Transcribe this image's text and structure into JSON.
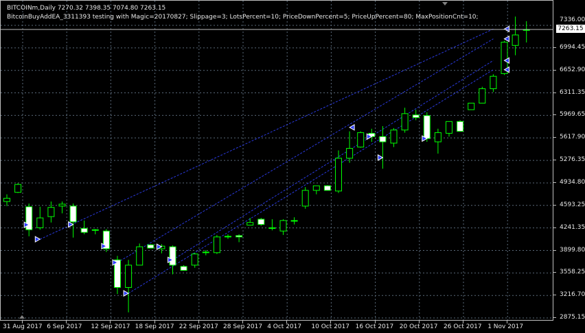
{
  "header": {
    "symbol_line": "BITCOINm,Daily  7270.32 7398.35 7074.80 7263.15",
    "ea_line": "BitcoinBuyAddEA_3311393 testing with Magic=20170827; Slippage=3; LotsPercent=10; PriceDownPercent=5; PriceUpPercent=80; MaxPositionCnt=10;"
  },
  "price_axis": {
    "labels": [
      "7336.00",
      "6994.45",
      "6652.90",
      "6311.35",
      "5969.65",
      "5617.90",
      "5276.35",
      "4934.80",
      "4593.25",
      "4241.35",
      "3899.80",
      "3558.25",
      "3216.70",
      "2875.15"
    ],
    "current_price": "7263.15"
  },
  "time_axis": {
    "labels": [
      "31 Aug 2017",
      "6 Sep 2017",
      "12 Sep 2017",
      "18 Sep 2017",
      "22 Sep 2017",
      "28 Sep 2017",
      "4 Oct 2017",
      "10 Oct 2017",
      "16 Oct 2017",
      "20 Oct 2017",
      "26 Oct 2017",
      "1 Nov 2017"
    ]
  },
  "colors": {
    "background": "#000000",
    "grid": "#5a6a7a",
    "bull_candle": "#000000",
    "bear_candle": "#ffffff",
    "candle_outline": "#00ff00",
    "trend_lines": "#2a3ae0",
    "arrow_marker": "#3040ff"
  },
  "chart_data": {
    "type": "candlestick",
    "series": [
      {
        "o": 4650,
        "h": 4760,
        "l": 4580,
        "c": 4700
      },
      {
        "o": 4790,
        "h": 4930,
        "l": 4780,
        "c": 4910
      },
      {
        "o": 4570,
        "h": 4620,
        "l": 4120,
        "c": 4220
      },
      {
        "o": 4250,
        "h": 4570,
        "l": 4220,
        "c": 4400
      },
      {
        "o": 4420,
        "h": 4650,
        "l": 4330,
        "c": 4560
      },
      {
        "o": 4580,
        "h": 4650,
        "l": 4470,
        "c": 4610
      },
      {
        "o": 4580,
        "h": 4620,
        "l": 4100,
        "c": 4340
      },
      {
        "o": 4240,
        "h": 4360,
        "l": 4150,
        "c": 4180
      },
      {
        "o": 4220,
        "h": 4230,
        "l": 4150,
        "c": 4210
      },
      {
        "o": 4200,
        "h": 4230,
        "l": 3880,
        "c": 3930
      },
      {
        "o": 3760,
        "h": 3820,
        "l": 3240,
        "c": 3340
      },
      {
        "o": 3340,
        "h": 3760,
        "l": 2960,
        "c": 3680
      },
      {
        "o": 3680,
        "h": 4010,
        "l": 3690,
        "c": 3960
      },
      {
        "o": 3990,
        "h": 4000,
        "l": 3960,
        "c": 3940
      },
      {
        "o": 3930,
        "h": 4000,
        "l": 3860,
        "c": 3970
      },
      {
        "o": 3960,
        "h": 3980,
        "l": 3540,
        "c": 3680
      },
      {
        "o": 3660,
        "h": 3680,
        "l": 3620,
        "c": 3600
      },
      {
        "o": 3680,
        "h": 3870,
        "l": 3640,
        "c": 3850
      },
      {
        "o": 3870,
        "h": 3910,
        "l": 3830,
        "c": 3880
      },
      {
        "o": 3870,
        "h": 4140,
        "l": 3850,
        "c": 4110
      },
      {
        "o": 4110,
        "h": 4150,
        "l": 4080,
        "c": 4120
      },
      {
        "o": 4130,
        "h": 4150,
        "l": 4030,
        "c": 4110
      },
      {
        "o": 4290,
        "h": 4400,
        "l": 4290,
        "c": 4330
      },
      {
        "o": 4380,
        "h": 4400,
        "l": 4280,
        "c": 4300
      },
      {
        "o": 4250,
        "h": 4380,
        "l": 4210,
        "c": 4250
      },
      {
        "o": 4200,
        "h": 4380,
        "l": 4140,
        "c": 4360
      },
      {
        "o": 4350,
        "h": 4410,
        "l": 4300,
        "c": 4360
      },
      {
        "o": 4580,
        "h": 4870,
        "l": 4540,
        "c": 4820
      },
      {
        "o": 4820,
        "h": 4880,
        "l": 4760,
        "c": 4890
      },
      {
        "o": 4890,
        "h": 4900,
        "l": 4840,
        "c": 4820
      },
      {
        "o": 4810,
        "h": 5430,
        "l": 4780,
        "c": 5310
      },
      {
        "o": 5310,
        "h": 5720,
        "l": 5240,
        "c": 5460
      },
      {
        "o": 5480,
        "h": 5720,
        "l": 5470,
        "c": 5700
      },
      {
        "o": 5690,
        "h": 5760,
        "l": 5560,
        "c": 5640
      },
      {
        "o": 5640,
        "h": 5800,
        "l": 5150,
        "c": 5560
      },
      {
        "o": 5540,
        "h": 5770,
        "l": 5480,
        "c": 5740
      },
      {
        "o": 5740,
        "h": 6080,
        "l": 5700,
        "c": 5990
      },
      {
        "o": 5970,
        "h": 6050,
        "l": 5890,
        "c": 5930
      },
      {
        "o": 5960,
        "h": 6010,
        "l": 5560,
        "c": 5610
      },
      {
        "o": 5560,
        "h": 5760,
        "l": 5380,
        "c": 5700
      },
      {
        "o": 5690,
        "h": 5870,
        "l": 5640,
        "c": 5870
      },
      {
        "o": 5870,
        "h": 5890,
        "l": 5740,
        "c": 5720
      },
      {
        "o": 6050,
        "h": 6100,
        "l": 6050,
        "c": 6150
      },
      {
        "o": 6150,
        "h": 6400,
        "l": 6150,
        "c": 6370
      },
      {
        "o": 6370,
        "h": 6590,
        "l": 6320,
        "c": 6560
      },
      {
        "o": 6600,
        "h": 7100,
        "l": 6580,
        "c": 7080
      },
      {
        "o": 7030,
        "h": 7470,
        "l": 6880,
        "c": 7190
      },
      {
        "o": 7270,
        "h": 7400,
        "l": 7075,
        "c": 7263
      }
    ],
    "buy_arrows": [
      {
        "i": 2,
        "p": 4295
      },
      {
        "i": 3,
        "p": 4075
      },
      {
        "i": 6,
        "p": 4300
      },
      {
        "i": 9,
        "p": 3970
      },
      {
        "i": 10,
        "p": 3720
      },
      {
        "i": 11,
        "p": 3250
      },
      {
        "i": 14,
        "p": 3960
      },
      {
        "i": 15,
        "p": 3760
      },
      {
        "i": 33,
        "p": 5640
      },
      {
        "i": 34,
        "p": 5320
      },
      {
        "i": 38,
        "p": 5610
      }
    ],
    "close_arrows": [
      {
        "i": 31,
        "p": 5780
      },
      {
        "i": 45,
        "p": 7280
      },
      {
        "i": 45,
        "p": 7130
      },
      {
        "i": 45,
        "p": 6800
      },
      {
        "i": 45,
        "p": 6660
      }
    ],
    "trend_lines": [
      {
        "from": {
          "i": 3,
          "p": 4075
        },
        "to": {
          "i": 44,
          "p": 7280
        }
      },
      {
        "from": {
          "i": 10,
          "p": 3720
        },
        "to": {
          "i": 44,
          "p": 7130
        }
      },
      {
        "from": {
          "i": 11,
          "p": 3250
        },
        "to": {
          "i": 44,
          "p": 6660
        }
      },
      {
        "from": {
          "i": 15,
          "p": 3760
        },
        "to": {
          "i": 44,
          "p": 6800
        }
      }
    ],
    "ylim": [
      2875.15,
      7336.0
    ]
  }
}
